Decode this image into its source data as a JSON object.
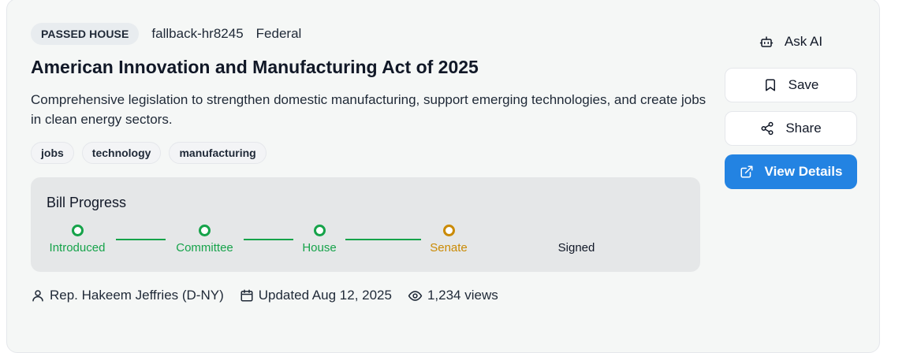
{
  "bill": {
    "status": "PASSED HOUSE",
    "id": "fallback-hr8245",
    "jurisdiction": "Federal",
    "title": "American Innovation and Manufacturing Act of 2025",
    "description": "Comprehensive legislation to strengthen domestic manufacturing, support emerging technologies, and create jobs in clean energy sectors.",
    "tags": [
      "jobs",
      "technology",
      "manufacturing"
    ]
  },
  "progress": {
    "title": "Bill Progress",
    "steps": [
      {
        "label": "Introduced",
        "state": "complete"
      },
      {
        "label": "Committee",
        "state": "complete"
      },
      {
        "label": "House",
        "state": "complete"
      },
      {
        "label": "Senate",
        "state": "current"
      },
      {
        "label": "Signed",
        "state": "pending"
      }
    ]
  },
  "footer": {
    "sponsor": "Rep. Hakeem Jeffries (D-NY)",
    "updated": "Updated Aug 12, 2025",
    "views": "1,234 views"
  },
  "actions": {
    "ask_ai": "Ask AI",
    "save": "Save",
    "share": "Share",
    "view_details": "View Details"
  },
  "colors": {
    "complete": "#16a34a",
    "current": "#ca8a04",
    "primary": "#2383e2"
  },
  "icons": [
    "bot-icon",
    "bookmark-icon",
    "share-icon",
    "external-link-icon",
    "user-icon",
    "calendar-icon",
    "eye-icon"
  ]
}
